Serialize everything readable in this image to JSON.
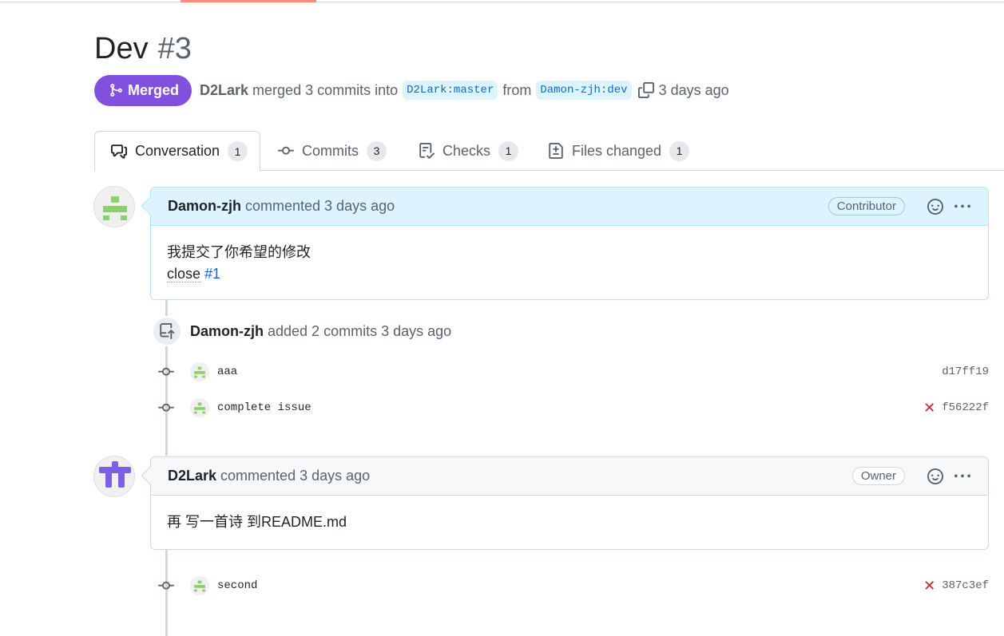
{
  "pr": {
    "title": "Dev",
    "number": "#3",
    "state": "Merged",
    "author": "D2Lark",
    "merge_text": "merged 3 commits into",
    "base_branch": "D2Lark:master",
    "from_text": "from",
    "head_branch": "Damon-zjh:dev",
    "time": "3 days ago"
  },
  "tabs": [
    {
      "label": "Conversation",
      "count": "1",
      "icon": "comment-discussion-icon"
    },
    {
      "label": "Commits",
      "count": "3",
      "icon": "git-commit-icon"
    },
    {
      "label": "Checks",
      "count": "1",
      "icon": "checklist-icon"
    },
    {
      "label": "Files changed",
      "count": "1",
      "icon": "file-diff-icon"
    }
  ],
  "comments": [
    {
      "author": "Damon-zjh",
      "action": "commented 3 days ago",
      "role": "Contributor",
      "body_line1": "我提交了你希望的修改",
      "body_close_word": "close",
      "body_link": "#1"
    },
    {
      "author": "D2Lark",
      "action": "commented 3 days ago",
      "role": "Owner",
      "body_line1": "再 写一首诗 到README.md"
    }
  ],
  "event": {
    "author": "Damon-zjh",
    "text": "added 2 commits 3 days ago"
  },
  "commits": [
    {
      "message": "aaa",
      "sha": "d17ff19",
      "status": ""
    },
    {
      "message": "complete issue",
      "sha": "f56222f",
      "status": "✕"
    },
    {
      "message": "second",
      "sha": "387c3ef",
      "status": "✕"
    }
  ],
  "colors": {
    "merged": "#8250df",
    "link": "#0969da",
    "fail": "#cf222e",
    "accent": "#fd8c73"
  }
}
